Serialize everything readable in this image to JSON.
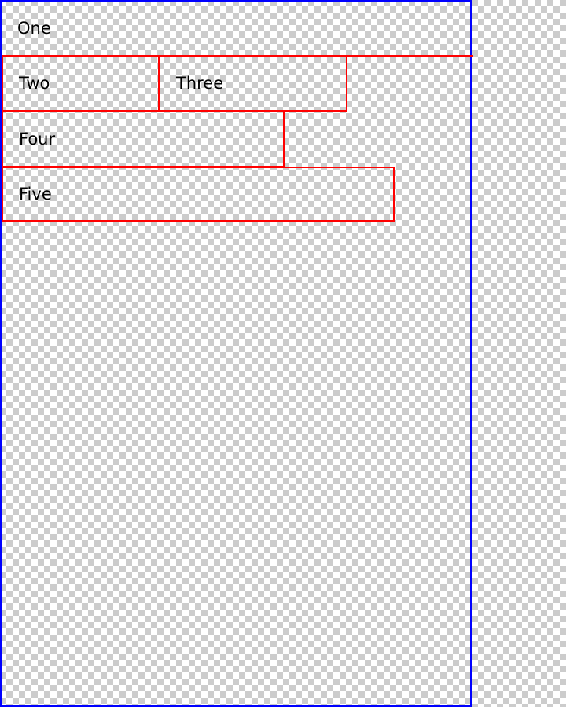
{
  "colors": {
    "container_border": "#0000ff",
    "box_border": "#ff0000",
    "text": "#000000"
  },
  "boxes": [
    {
      "label": "One"
    },
    {
      "label": "Two"
    },
    {
      "label": "Three"
    },
    {
      "label": "Four"
    },
    {
      "label": "Five"
    }
  ]
}
